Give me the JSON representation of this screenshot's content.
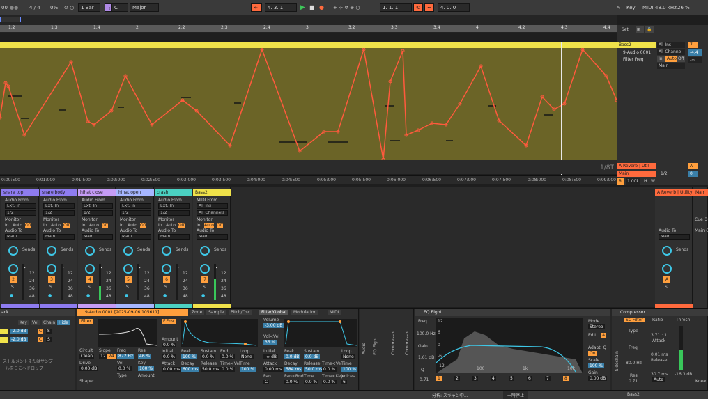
{
  "topbar": {
    "left_counter": "00",
    "meter": "4 / 4",
    "cpu": "0%",
    "quantize": "1 Bar",
    "key_root": "C",
    "scale": "Major",
    "position": "4.  3.  1",
    "loop_start": "1.  1.  1",
    "loop_length": "4.  0.  0",
    "key_label": "Key",
    "midi_label": "MIDI",
    "sample_rate": "48.0 kHz",
    "cpu_load": "26 %"
  },
  "ruler_ticks": [
    "1.2",
    "1.3",
    "1.4",
    "2",
    "2.2",
    "2.3",
    "2.4",
    "3",
    "3.2",
    "3.3",
    "3.4",
    "4",
    "4.2",
    "4.3",
    "4.4"
  ],
  "timeline_labels": [
    "0:00:500",
    "0:01:000",
    "0:01:500",
    "0:02:000",
    "0:02:500",
    "0:03:000",
    "0:03:500",
    "0:04:000",
    "0:04:500",
    "0:05:000",
    "0:05:500",
    "0:06:000",
    "0:06:500",
    "0:07:000",
    "0:07:500",
    "0:08:000",
    "0:08:500",
    "0:09:000"
  ],
  "grid_label": "1/8T",
  "track_header": {
    "set_label": "Set",
    "track_name": "Bass2",
    "track_number": "7",
    "device": "9-Audio 0001",
    "param": "Filter Freq",
    "input": "All Ins",
    "channel": "All Channe",
    "monitor_in": "In",
    "monitor_auto": "Auto",
    "monitor_off": "Off",
    "output": "Main",
    "volume": "-4.4",
    "pan": "-∞",
    "return_a": "A Reverb | Util",
    "return_a_letter": "A",
    "main_label": "Main",
    "main_time": "1/2",
    "main_val": "0",
    "zoom": "1.00k",
    "h_btn": "H",
    "w_btn": "W"
  },
  "strips": [
    {
      "name": "snare top",
      "color": "#8e7cf0",
      "num": "2",
      "vol": "-∞"
    },
    {
      "name": "snare body",
      "color": "#8e7cf0",
      "num": "3",
      "vol": "-∞"
    },
    {
      "name": "hihat close",
      "color": "#c59cf5",
      "num": "4",
      "vol": "-∞"
    },
    {
      "name": "hihat open",
      "color": "#a6b6ff",
      "num": "5",
      "vol": "-∞"
    },
    {
      "name": "crash",
      "color": "#4bd1c2",
      "num": "6",
      "vol": "-∞"
    },
    {
      "name": "Bass2",
      "color": "#f0e24a",
      "num": "7",
      "vol": "-∞"
    }
  ],
  "strip_common": {
    "audio_from": "Audio From",
    "ext_in": "Ext. In",
    "ch": "1/2",
    "monitor": "Monitor",
    "in": "In",
    "auto": "Auto",
    "off": "Off",
    "audio_to": "Audio To",
    "main": "Main",
    "sends": "Sends",
    "midi_from": "MIDI From",
    "all_ins": "All Ins",
    "all_channels": "All Channels",
    "scale_12": "12",
    "scale_24": "24",
    "scale_36": "36",
    "scale_48": "48"
  },
  "return_strip": {
    "name": "A Reverb | Utility",
    "letter": "A",
    "audio_to": "Audio To",
    "main": "Main",
    "sends": "Sends"
  },
  "main_strip": {
    "name": "Main",
    "cue_out": "Cue Ou",
    "main_out": "Main O"
  },
  "devices": {
    "rack_label": "ack",
    "rack_key": "Key",
    "rack_vel": "Vel",
    "rack_chain": "Chain",
    "rack_hide": "Hide",
    "rack_chain_vals": [
      "-2.0 dB",
      "-2.0 dB"
    ],
    "rack_drop_line1": "ストルメントまたはサンプ",
    "rack_drop_line2": "ルをここへドロップ",
    "simpler_title": "9-Audio 0001 [2025-09-06 105611]",
    "simpler_tabs": [
      "Zone",
      "Sample",
      "Pitch/Osc",
      "Filter/Global",
      "Modulation",
      "MIDI"
    ],
    "filter_label": "Filter",
    "circuit": "Circuit",
    "circuit_val": "Clean",
    "slope": "Slope",
    "slope_12": "12",
    "slope_24": "24",
    "freq": "Freq",
    "freq_val": "872 Hz",
    "res": "Res",
    "res_val": "46 %",
    "drive": "Drive",
    "drive_val": "0.00 dB",
    "vel": "Vel",
    "vel_val": "0.0 %",
    "key": "Key",
    "key_val": "100 %",
    "shaper": "Shaper",
    "type": "Type",
    "amount": "Amount",
    "fenv": "F.Env",
    "env_amount": "Amount",
    "env_amount_val": "0.0 %",
    "env_labels": [
      "Initial",
      "Peak",
      "Sustain",
      "End",
      "Loop"
    ],
    "env_vals": [
      "0.0 %",
      "100 %",
      "0.0 %",
      "0.0 %",
      "None"
    ],
    "env_time_labels": [
      "Attack",
      "Decay",
      "Release",
      "Time<Vel",
      "Time"
    ],
    "env_time_vals": [
      "0.00 ms",
      "600 ms",
      "50.0 ms",
      "0.0 %",
      "100 %"
    ],
    "volume": "Volume",
    "volume_val": "-3.00 dB",
    "vol_vel": "Vol<Vel",
    "vol_vel_val": "35 %",
    "amp_labels": [
      "Initial",
      "Peak",
      "Sustain",
      "Loop"
    ],
    "amp_vals": [
      "-∞ dB",
      "0.0 dB",
      "0.0 dB",
      "None"
    ],
    "amp_time_labels": [
      "Attack",
      "Decay",
      "Release",
      "Time<Vel",
      "Time"
    ],
    "amp_time_vals": [
      "0.00 ms",
      "584 ms",
      "50.0 ms",
      "0.0 %",
      "100 %"
    ],
    "pan": "Pan",
    "pan_val": "C",
    "pan_rnd": "Pan<Rnd",
    "pan_rnd_val": "0.0 %",
    "time": "Time",
    "time_val": "0.0 %",
    "time_key": "Time<Key",
    "time_key_val": "0.0 %",
    "voices": "Voices",
    "voices_val": "6",
    "audio_label": "Audio",
    "eq8_vlabel": "EQ Eight",
    "comp_vlabel": "Compressor",
    "eq_title": "EQ Eight",
    "eq_freq": "Freq",
    "eq_freq_val": "100.0 Hz",
    "eq_gain": "Gain",
    "eq_gain_val": "1.61 dB",
    "eq_q": "Q",
    "eq_q_val": "0.71",
    "eq_scale": [
      "12",
      "6",
      "0",
      "-6",
      "-12"
    ],
    "eq_axis": [
      "100",
      "1k",
      "10k"
    ],
    "eq_bands": [
      "1",
      "2",
      "3",
      "4",
      "5",
      "6",
      "7",
      "8"
    ],
    "eq_mode": "Mode",
    "eq_mode_val": "Stereo",
    "eq_edit": "Edit",
    "eq_edit_a": "A",
    "eq_adapt": "Adapt. Q",
    "eq_adapt_val": "On",
    "eq_scale_label": "Scale",
    "eq_scale_val": "100 %",
    "eq_gain2": "Gain",
    "eq_gain2_val": "0.00 dB",
    "sidechain": "Sidechain",
    "comp_title": "Compressor",
    "sc_filter": "SC Filter",
    "comp_type": "Type",
    "comp_freq": "Freq",
    "comp_freq_val": "80.0 Hz",
    "comp_res": "Res",
    "comp_res_val": "0.71",
    "ratio": "Ratio",
    "ratio_val": "3.71 : 1",
    "attack": "Attack",
    "attack_val": "0.01 ms",
    "release": "Release",
    "release_val": "30.7 ms",
    "auto": "Auto",
    "thresh": "Thresh",
    "thresh_val": "-16.3 dB",
    "knee": "Knee"
  },
  "status": {
    "analysis": "分析: スキャン中...",
    "pause": "一時停止",
    "track": "Bass2"
  }
}
